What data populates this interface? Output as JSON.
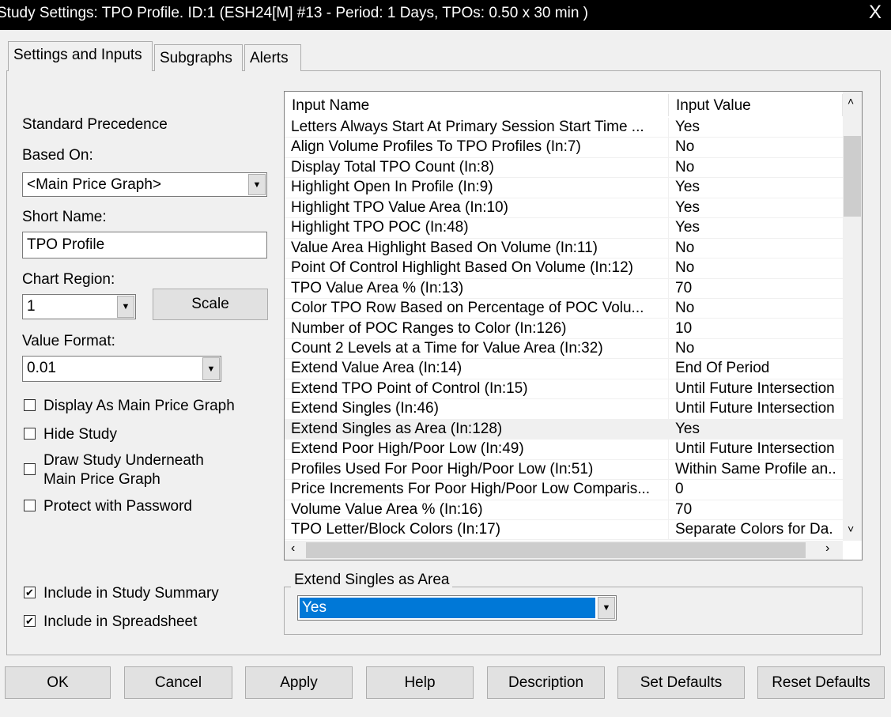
{
  "window": {
    "title": "Study Settings: TPO Profile. ID:1 (ESH24[M] #13 - Period: 1 Days, TPOs: 0.50 x 30 min  )",
    "close": "X"
  },
  "tabs": [
    "Settings and Inputs",
    "Subgraphs",
    "Alerts"
  ],
  "left": {
    "standard_precedence": "Standard Precedence",
    "based_on_label": "Based On:",
    "based_on_value": "<Main Price Graph>",
    "short_name_label": "Short Name:",
    "short_name_value": "TPO Profile",
    "chart_region_label": "Chart Region:",
    "chart_region_value": "1",
    "scale_button": "Scale",
    "value_format_label": "Value Format:",
    "value_format_value": "0.01",
    "checkboxes": [
      {
        "label": "Display As Main Price Graph",
        "checked": false
      },
      {
        "label": "Hide Study",
        "checked": false
      },
      {
        "label": "Draw Study Underneath Main Price Graph",
        "line1": "Draw Study Underneath",
        "line2": "Main Price Graph",
        "checked": false
      },
      {
        "label": "Protect with Password",
        "checked": false
      },
      {
        "label": "Include in Study Summary",
        "checked": true
      },
      {
        "label": "Include in Spreadsheet",
        "checked": true
      }
    ]
  },
  "grid": {
    "columns": [
      "Input Name",
      "Input Value"
    ],
    "rows": [
      [
        "Letters Always Start At Primary Session Start Time   ...",
        "Yes"
      ],
      [
        "Align Volume Profiles To TPO Profiles   (In:7)",
        "No"
      ],
      [
        "Display Total TPO Count   (In:8)",
        "No"
      ],
      [
        "Highlight Open In Profile   (In:9)",
        "Yes"
      ],
      [
        "Highlight TPO Value Area   (In:10)",
        "Yes"
      ],
      [
        "Highlight TPO POC   (In:48)",
        "Yes"
      ],
      [
        "Value Area Highlight Based On Volume   (In:11)",
        "No"
      ],
      [
        "Point Of Control Highlight Based On Volume   (In:12)",
        "No"
      ],
      [
        "TPO Value Area %   (In:13)",
        "70"
      ],
      [
        "Color TPO Row Based on Percentage of POC Volu...",
        "No"
      ],
      [
        "Number of POC Ranges to Color   (In:126)",
        "10"
      ],
      [
        "Count 2 Levels at a Time for Value Area   (In:32)",
        "No"
      ],
      [
        "Extend Value Area   (In:14)",
        "End Of Period"
      ],
      [
        "Extend TPO Point of Control   (In:15)",
        "Until Future Intersection"
      ],
      [
        "Extend Singles   (In:46)",
        "Until Future Intersection"
      ],
      [
        "Extend Singles as Area   (In:128)",
        "Yes"
      ],
      [
        "Extend Poor High/Poor Low   (In:49)",
        "Until Future Intersection"
      ],
      [
        "Profiles Used For Poor High/Poor Low   (In:51)",
        "Within Same Profile an.."
      ],
      [
        "Price Increments For Poor High/Poor Low Comparis...",
        "0"
      ],
      [
        "Volume Value Area %   (In:16)",
        "70"
      ],
      [
        "TPO Letter/Block Colors   (In:17)",
        "Separate Colors for Da."
      ]
    ],
    "selected_row": 15
  },
  "editor": {
    "label": "Extend Singles as Area",
    "value": "Yes",
    "accent": "#0078d7"
  },
  "buttons": [
    "OK",
    "Cancel",
    "Apply",
    "Help",
    "Description",
    "Set Defaults",
    "Reset Defaults"
  ]
}
